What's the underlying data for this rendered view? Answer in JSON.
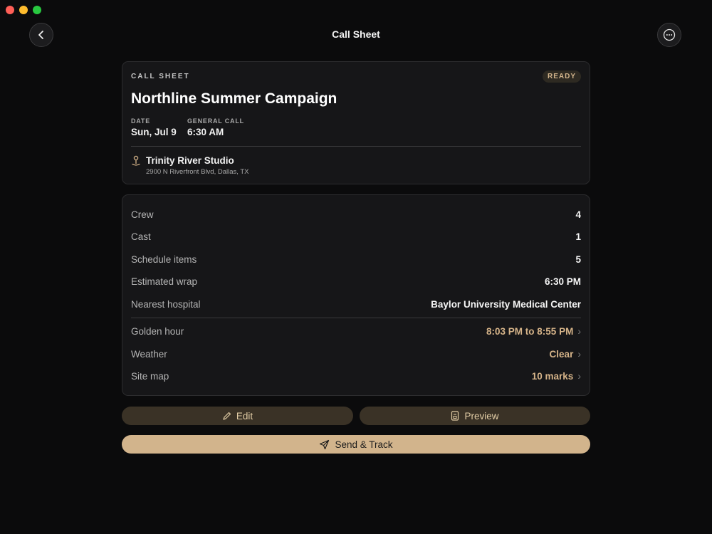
{
  "window": {
    "title": "Call Sheet"
  },
  "icons": {
    "back": "chevron-left-icon",
    "more": "ellipsis-icon",
    "location": "map-pin-icon",
    "edit": "pencil-icon",
    "preview": "document-icon",
    "send": "paper-plane-icon",
    "chevron": "chevron-right-icon"
  },
  "colors": {
    "background": "#0b0b0c",
    "card": "#161618",
    "accent": "#d2b48c",
    "badge_bg": "#2e2a22"
  },
  "summary": {
    "kicker": "CALL SHEET",
    "status": "READY",
    "project": "Northline Summer Campaign",
    "date_label": "DATE",
    "date_value": "Sun, Jul 9",
    "call_label": "GENERAL CALL",
    "call_value": "6:30 AM",
    "location_name": "Trinity River Studio",
    "location_address": "2900 N Riverfront Blvd, Dallas, TX"
  },
  "details": {
    "rows": [
      {
        "label": "Crew",
        "value": "4"
      },
      {
        "label": "Cast",
        "value": "1"
      },
      {
        "label": "Schedule items",
        "value": "5"
      },
      {
        "label": "Estimated wrap",
        "value": "6:30 PM"
      },
      {
        "label": "Nearest hospital",
        "value": "Baylor University Medical Center"
      }
    ],
    "links": [
      {
        "label": "Golden hour",
        "value": "8:03 PM to 8:55 PM"
      },
      {
        "label": "Weather",
        "value": "Clear"
      },
      {
        "label": "Site map",
        "value": "10 marks"
      }
    ]
  },
  "actions": {
    "edit": "Edit",
    "preview": "Preview",
    "send": "Send & Track"
  }
}
